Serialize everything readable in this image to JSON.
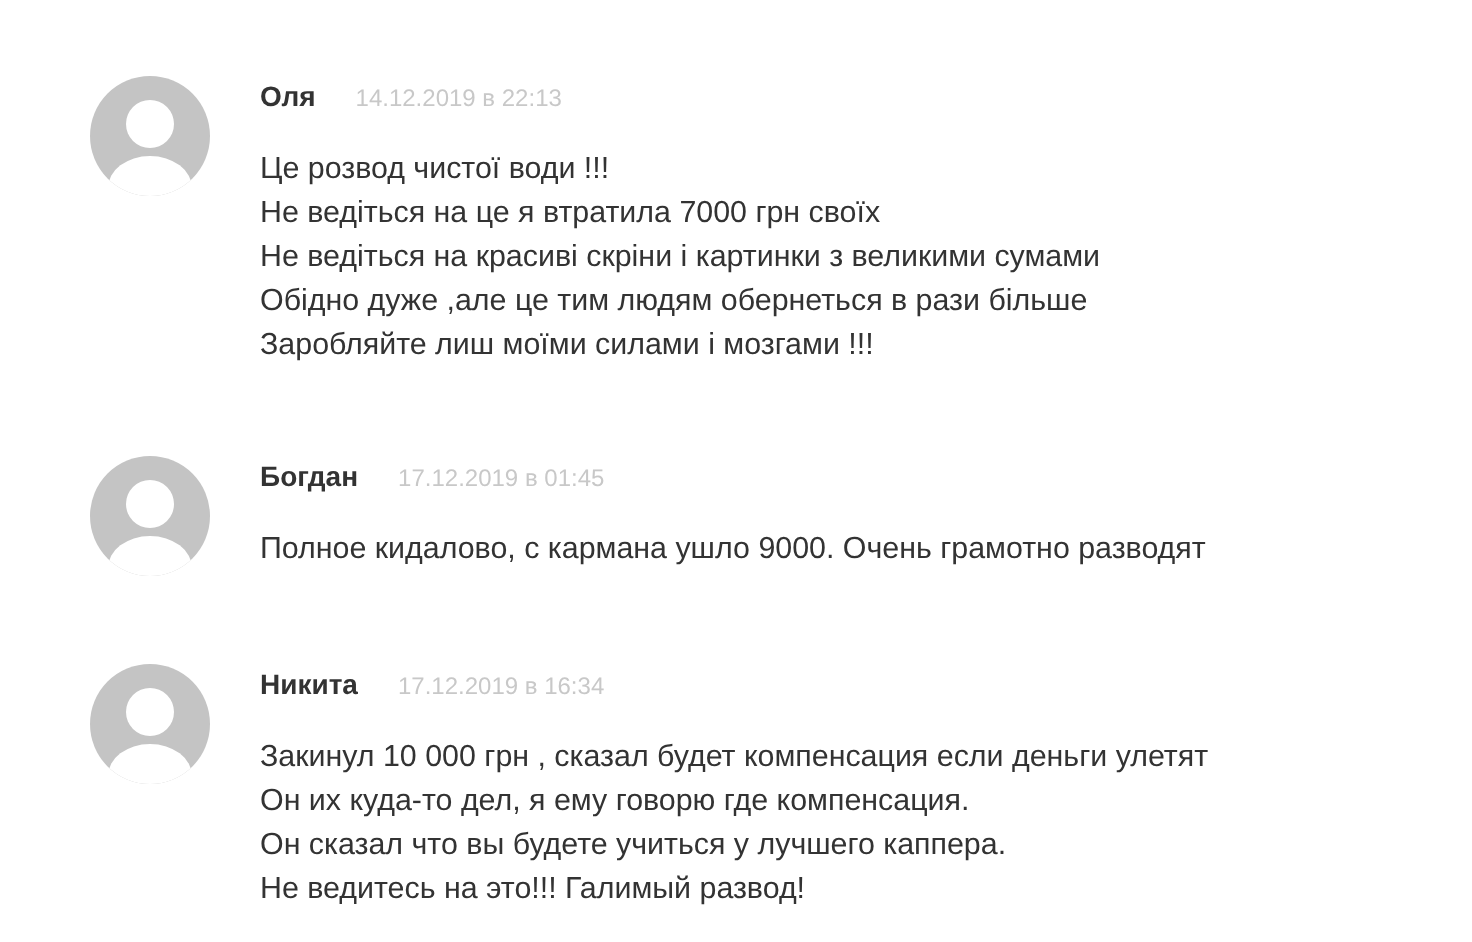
{
  "comments": [
    {
      "author": "Оля",
      "date": "14.12.2019 в 22:13",
      "lines": [
        "Це розвод чистої води !!!",
        "Не ведіться на це я втратила 7000 грн своїх",
        "Не ведіться на красиві скріни і картинки з великими сумами",
        "Обідно дуже ,але це тим людям обернеться в рази більше",
        "Заробляйте лиш моїми силами і мозгами !!!"
      ]
    },
    {
      "author": "Богдан",
      "date": "17.12.2019 в 01:45",
      "lines": [
        "Полное кидалово, с кармана ушло 9000. Очень грамотно разводят"
      ]
    },
    {
      "author": "Никита",
      "date": "17.12.2019 в 16:34",
      "lines": [
        "Закинул 10 000 грн , сказал будет компенсация если деньги улетят",
        "Он их куда-то дел, я ему говорю где компенсация.",
        "Он сказал что вы будете учиться у лучшего каппера.",
        "Не ведитесь на это!!! Галимый развод!"
      ]
    }
  ]
}
